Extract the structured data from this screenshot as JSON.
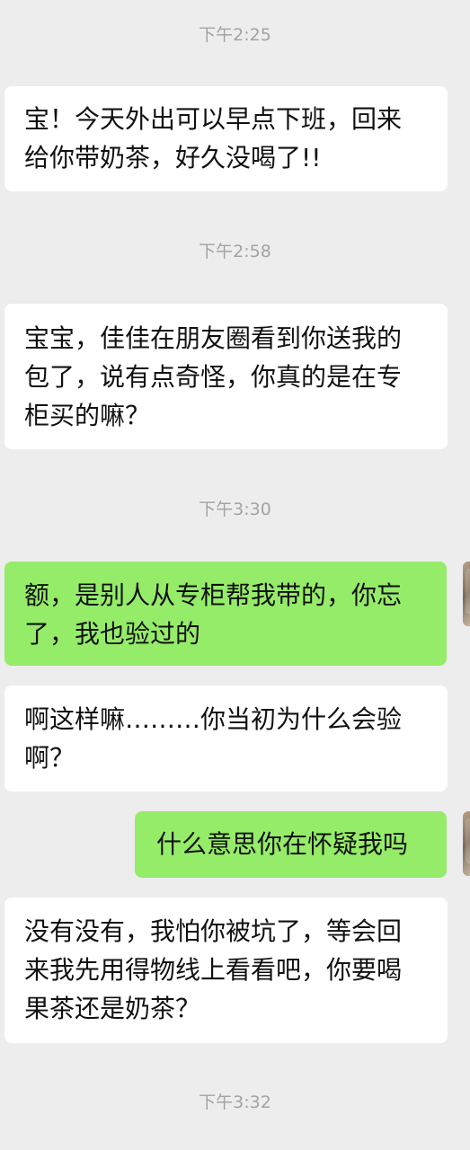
{
  "conversation": {
    "times": [
      "下午2:25",
      "下午2:58",
      "下午3:30",
      "下午3:32"
    ],
    "messages": [
      {
        "side": "incoming",
        "text": "宝！今天外出可以早点下班，回来\n给你带奶茶，好久没喝了!!"
      },
      {
        "side": "incoming",
        "text": "宝宝，佳佳在朋友圈看到你送我的\n包了，说有点奇怪，你真的是在专\n柜买的嘛？"
      },
      {
        "side": "outgoing",
        "text": "额，是别人从专柜帮我带的，你忘\n了，我也验过的"
      },
      {
        "side": "incoming",
        "text": "啊这样嘛………你当初为什么会验\n啊？"
      },
      {
        "side": "outgoing",
        "text": "什么意思你在怀疑我吗"
      },
      {
        "side": "incoming",
        "text": "没有没有，我怕你被坑了，等会回\n来我先用得物线上看看吧，你要喝\n果茶还是奶茶？"
      }
    ]
  },
  "colors": {
    "background": "#ededed",
    "incoming_bubble": "#ffffff",
    "outgoing_bubble": "#95ec69",
    "timestamp": "#a3a3a3"
  },
  "icons": [
    "user-avatar-icon"
  ]
}
